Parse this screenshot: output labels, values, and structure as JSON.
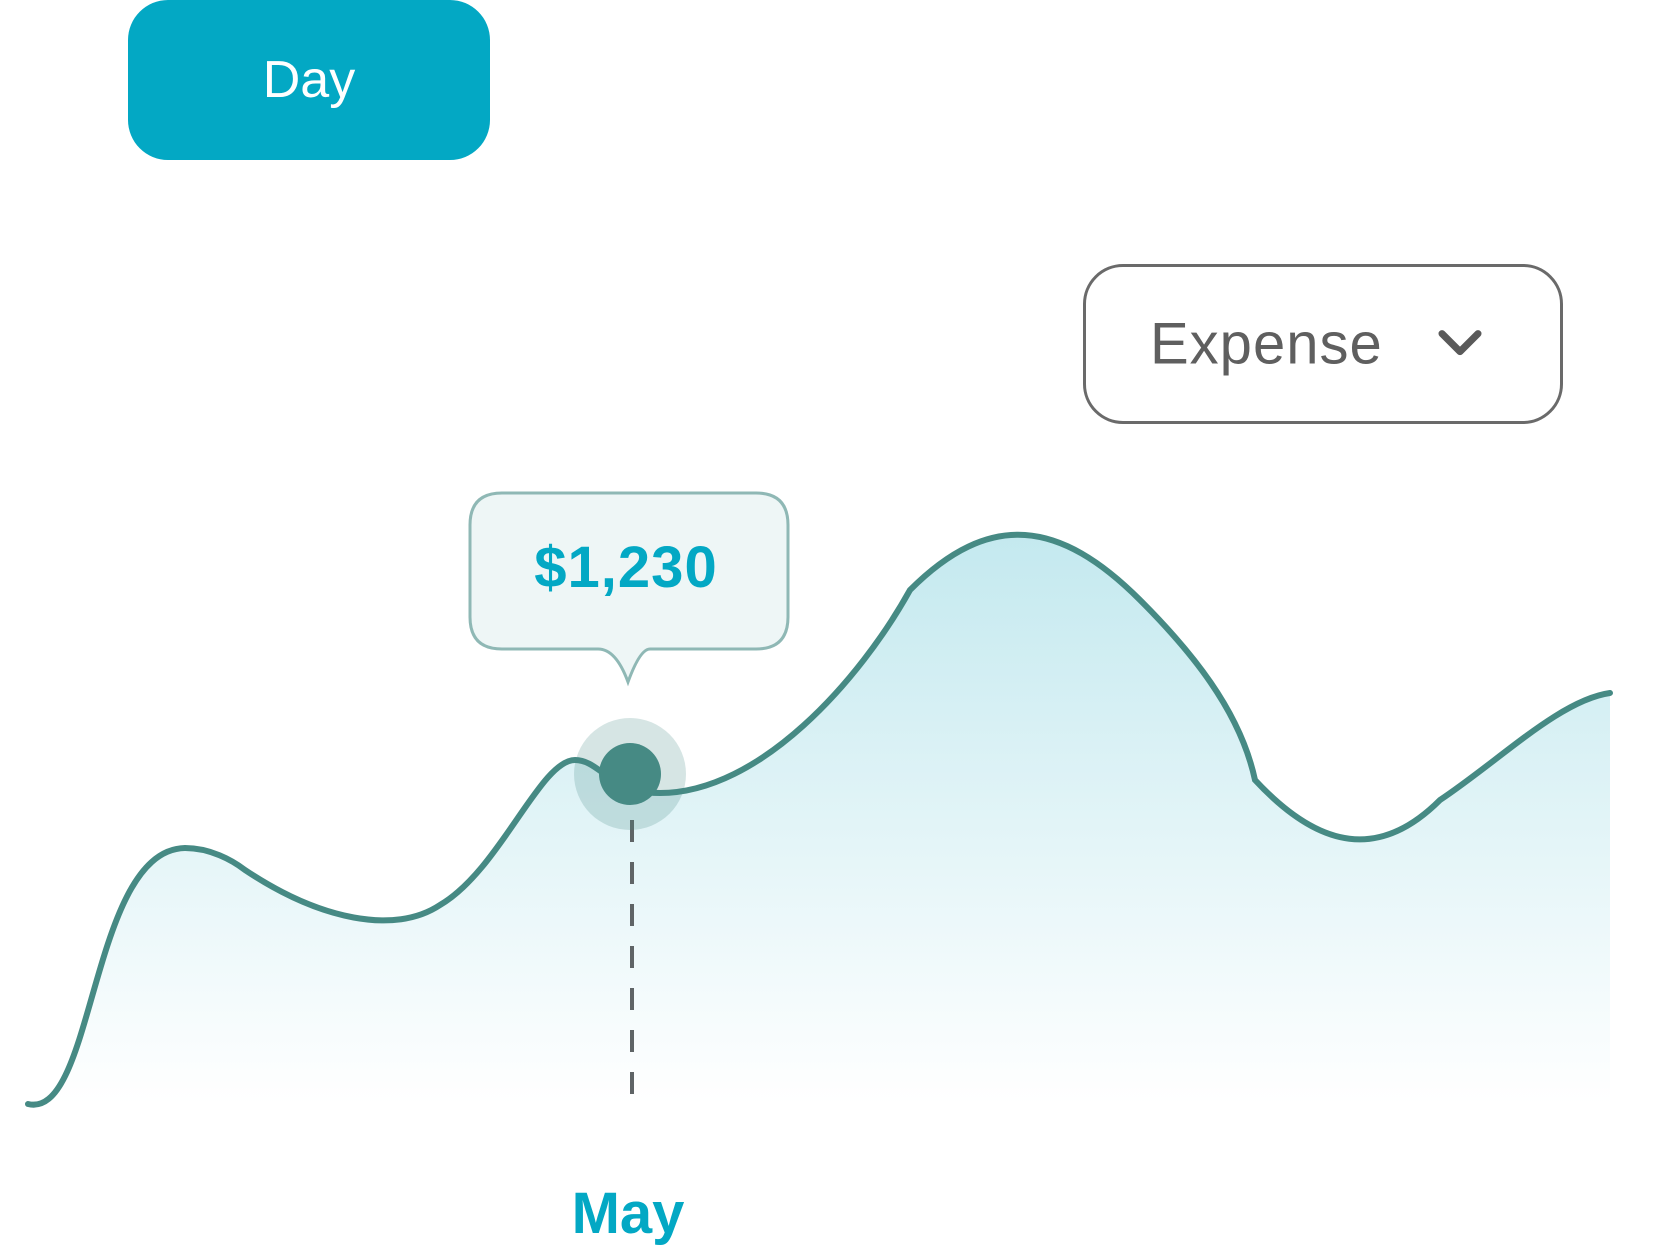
{
  "period_button": {
    "label": "Day"
  },
  "dropdown": {
    "label": "Expense",
    "icon": "chevron-down-icon"
  },
  "tooltip": {
    "value": "$1,230"
  },
  "colors": {
    "accent": "#03a8c4",
    "line": "#468a84",
    "area_top": "#c4e9ef",
    "tooltip_bg": "#eef6f6",
    "tooltip_border": "#8fb8b5"
  },
  "chart_data": {
    "type": "area",
    "selected_label": "May",
    "selected_value": 1230,
    "grid": false,
    "legend": "none"
  }
}
